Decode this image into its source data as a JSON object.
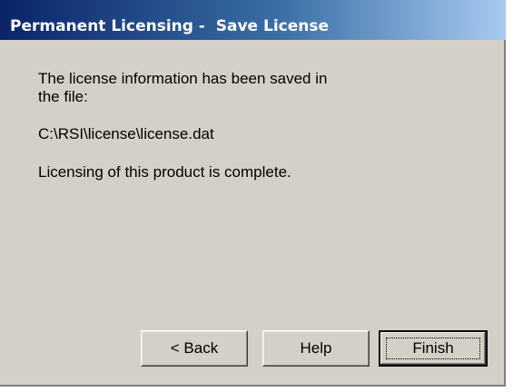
{
  "window": {
    "title": "Permanent Licensing -  Save License"
  },
  "content": {
    "message_saved": "The license information has been saved in the file:",
    "file_path": "C:\\RSI\\license\\license.dat",
    "message_complete": "Licensing of this product is complete."
  },
  "buttons": {
    "back_label": "< Back",
    "help_label": "Help",
    "finish_label": "Finish"
  },
  "colors": {
    "titlebar_start": "#0a246a",
    "titlebar_end": "#a6caf0",
    "dialog_background": "#d4d0c8"
  }
}
